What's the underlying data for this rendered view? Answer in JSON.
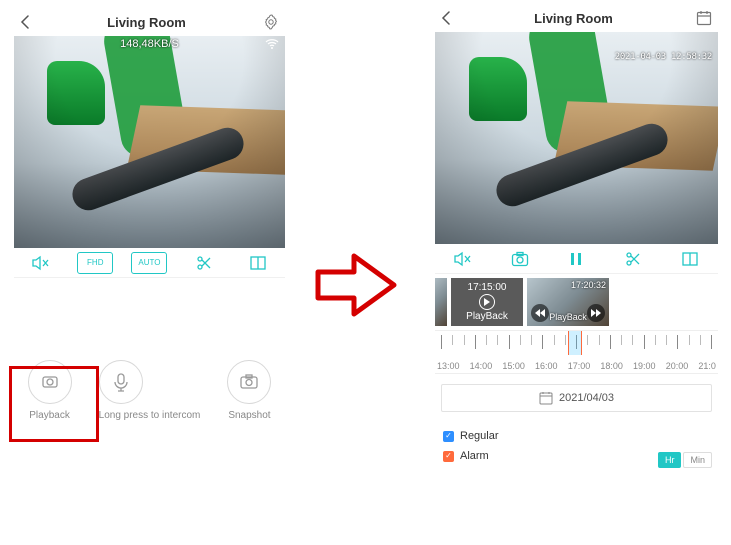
{
  "accent": "#21c7c5",
  "live": {
    "header": {
      "title": "Living Room"
    },
    "video": {
      "bitrate": "148,48KB/S",
      "wifi_icon": "wifi"
    },
    "toolbar": {
      "mute_label": "Mute",
      "fhd_label": "FHD",
      "auto_label": "AUTO",
      "cut_label": "Cut",
      "window_label": "Fullscreen"
    },
    "actions": {
      "playback": {
        "label": "Playback"
      },
      "intercom": {
        "label": "Long press to intercom"
      },
      "snapshot": {
        "label": "Snapshot"
      }
    }
  },
  "playback": {
    "header": {
      "title": "Living Room"
    },
    "video": {
      "timestamp": "2021-04-03 12:58:32"
    },
    "toolbar": {
      "mute_label": "Mute",
      "snapshot_label": "Snapshot",
      "pause_label": "Pause",
      "cut_label": "Cut",
      "window_label": "Fullscreen"
    },
    "clips": [
      {
        "time": "17:15:00",
        "label": "PlayBack"
      },
      {
        "time": "17:20:32",
        "label": "PlayBack"
      }
    ],
    "timeline": {
      "hours": [
        "13:00",
        "14:00",
        "15:00",
        "16:00",
        "17:00",
        "18:00",
        "19:00",
        "20:00",
        "21:0"
      ],
      "scrubber_pct": 47
    },
    "date": "2021/04/03",
    "legend": {
      "regular": "Regular",
      "alarm": "Alarm"
    },
    "zoom": {
      "hr": "Hr",
      "min": "Min",
      "active": "hr"
    }
  }
}
